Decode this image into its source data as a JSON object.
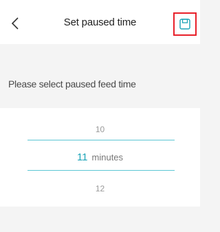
{
  "header": {
    "title": "Set paused time",
    "back_icon": "chevron-left-icon",
    "save_icon": "floppy-disk-icon",
    "highlight_color": "#e8202a"
  },
  "prompt": "Please select paused feed time",
  "picker": {
    "options_before": [
      "10"
    ],
    "selected_value": "11",
    "unit": "minutes",
    "options_after": [
      "12"
    ],
    "accent_color": "#1aa3b7"
  }
}
